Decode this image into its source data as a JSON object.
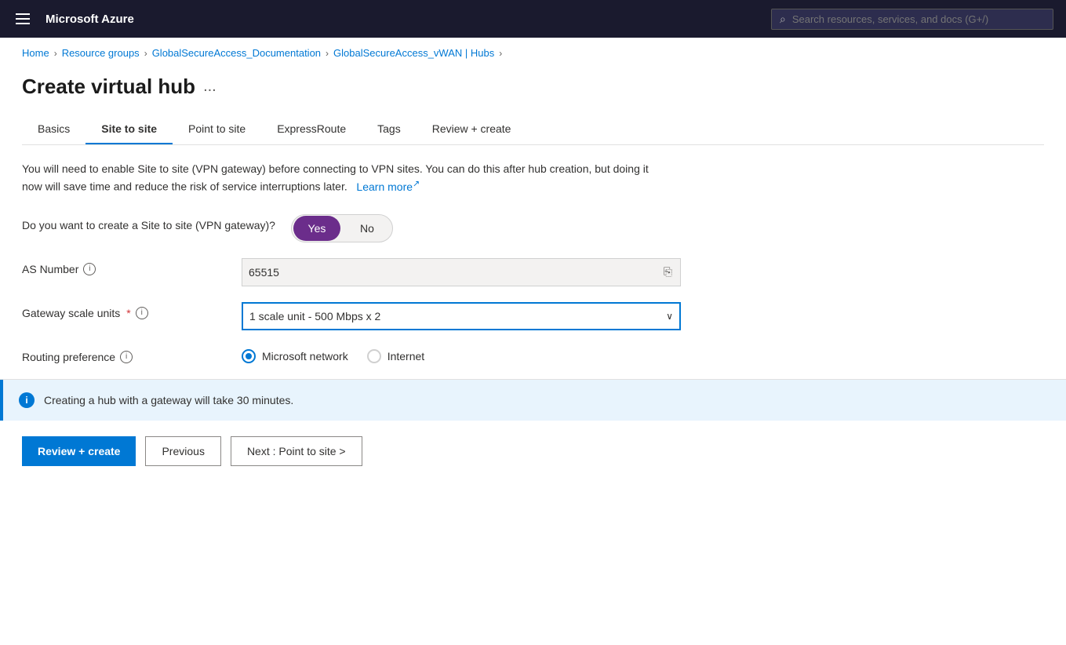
{
  "topbar": {
    "title": "Microsoft Azure",
    "search_placeholder": "Search resources, services, and docs (G+/)"
  },
  "breadcrumb": {
    "items": [
      {
        "label": "Home",
        "link": true
      },
      {
        "label": "Resource groups",
        "link": true
      },
      {
        "label": "GlobalSecureAccess_Documentation",
        "link": true
      },
      {
        "label": "GlobalSecureAccess_vWAN | Hubs",
        "link": true
      }
    ]
  },
  "page": {
    "title": "Create virtual hub",
    "ellipsis": "..."
  },
  "tabs": [
    {
      "label": "Basics",
      "active": false
    },
    {
      "label": "Site to site",
      "active": true
    },
    {
      "label": "Point to site",
      "active": false
    },
    {
      "label": "ExpressRoute",
      "active": false
    },
    {
      "label": "Tags",
      "active": false
    },
    {
      "label": "Review + create",
      "active": false
    }
  ],
  "description": {
    "text": "You will need to enable Site to site (VPN gateway) before connecting to VPN sites. You can do this after hub creation, but doing it now will save time and reduce the risk of service interruptions later.",
    "learn_more_label": "Learn more"
  },
  "form": {
    "vpn_question_label": "Do you want to create a Site to site (VPN gateway)?",
    "toggle_yes": "Yes",
    "toggle_no": "No",
    "as_number_label": "AS Number",
    "as_number_value": "65515",
    "gateway_scale_label": "Gateway scale units",
    "required_mark": "*",
    "gateway_scale_value": "1 scale unit - 500 Mbps x 2",
    "routing_preference_label": "Routing preference",
    "routing_options": [
      {
        "label": "Microsoft network",
        "selected": true
      },
      {
        "label": "Internet",
        "selected": false
      }
    ]
  },
  "info_banner": {
    "text": "Creating a hub with a gateway will take 30 minutes."
  },
  "actions": {
    "review_create": "Review + create",
    "previous": "Previous",
    "next": "Next : Point to site >"
  }
}
